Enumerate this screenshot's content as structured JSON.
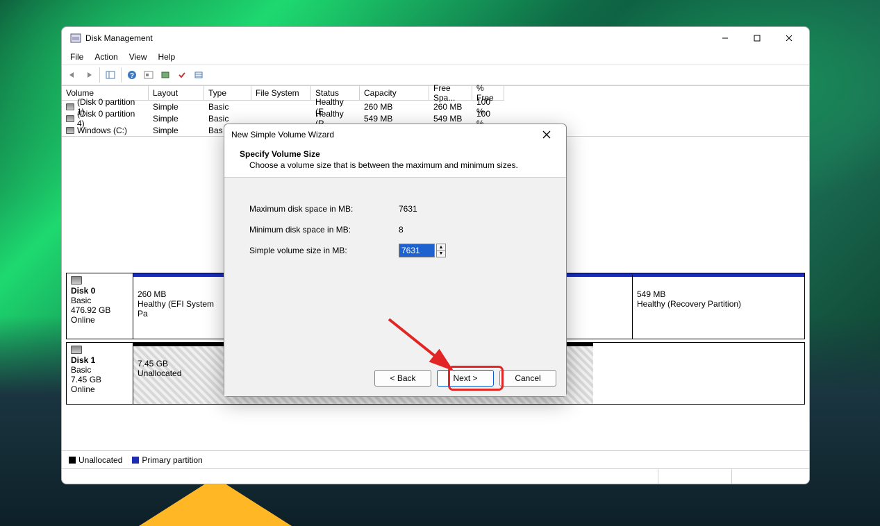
{
  "window": {
    "title": "Disk Management",
    "menu": {
      "file": "File",
      "action": "Action",
      "view": "View",
      "help": "Help"
    },
    "win_controls": {
      "min": "minimize",
      "max": "maximize",
      "close": "close"
    }
  },
  "table": {
    "headers": {
      "volume": "Volume",
      "layout": "Layout",
      "type": "Type",
      "fs": "File System",
      "status": "Status",
      "capacity": "Capacity",
      "free": "Free Spa...",
      "pct": "% Free"
    },
    "rows": [
      {
        "volume": "(Disk 0 partition 1)",
        "layout": "Simple",
        "type": "Basic",
        "fs": "",
        "status": "Healthy (E...",
        "capacity": "260 MB",
        "free": "260 MB",
        "pct": "100 %"
      },
      {
        "volume": "(Disk 0 partition 4)",
        "layout": "Simple",
        "type": "Basic",
        "fs": "",
        "status": "Healthy (R...",
        "capacity": "549 MB",
        "free": "549 MB",
        "pct": "100 %"
      },
      {
        "volume": "Windows (C:)",
        "layout": "Simple",
        "type": "Bas",
        "fs": "",
        "status": "",
        "capacity": "",
        "free": "",
        "pct": ""
      }
    ]
  },
  "disks": {
    "d0": {
      "name": "Disk 0",
      "type": "Basic",
      "size": "476.92 GB",
      "state": "Online",
      "p1_size": "260 MB",
      "p1_status": "Healthy (EFI System Pa",
      "p4_size": "549 MB",
      "p4_status": "Healthy (Recovery Partition)"
    },
    "d1": {
      "name": "Disk 1",
      "type": "Basic",
      "size": "7.45 GB",
      "state": "Online",
      "u_size": "7.45 GB",
      "u_status": "Unallocated"
    }
  },
  "legend": {
    "unallocated": "Unallocated",
    "primary": "Primary partition"
  },
  "wizard": {
    "title": "New Simple Volume Wizard",
    "heading": "Specify Volume Size",
    "sub": "Choose a volume size that is between the maximum and minimum sizes.",
    "max_label": "Maximum disk space in MB:",
    "max_val": "7631",
    "min_label": "Minimum disk space in MB:",
    "min_val": "8",
    "size_label": "Simple volume size in MB:",
    "size_val": "7631",
    "back": "< Back",
    "next": "Next >",
    "cancel": "Cancel"
  }
}
